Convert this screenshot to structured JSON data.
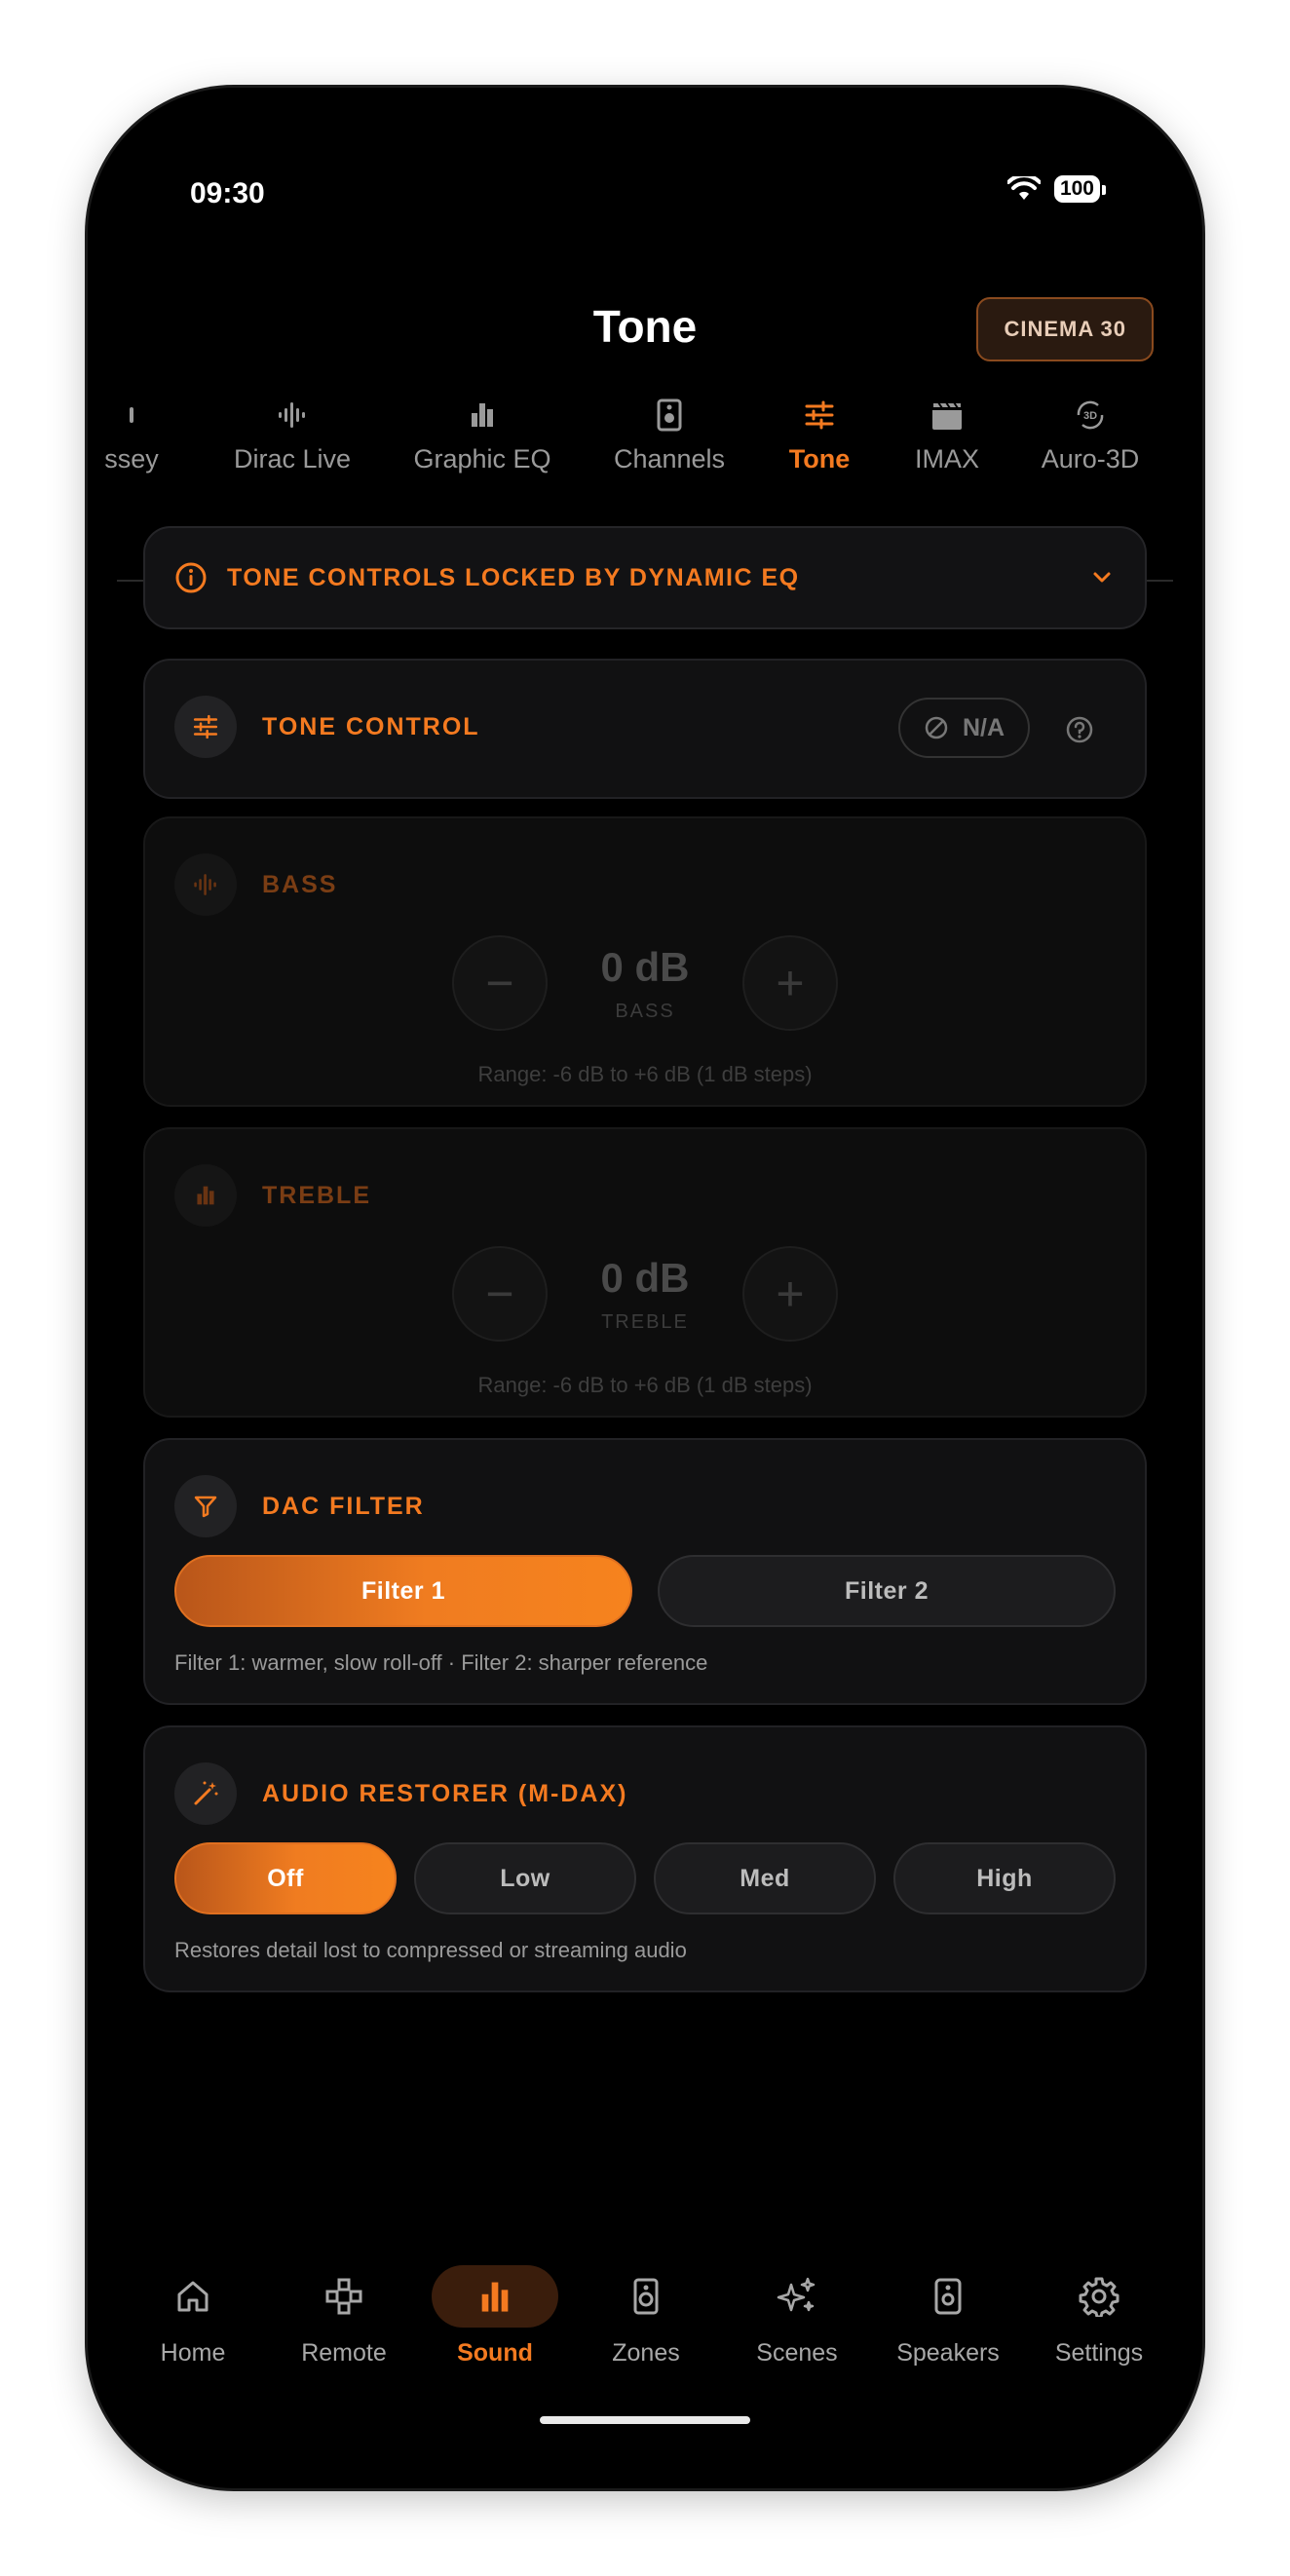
{
  "status": {
    "time": "09:30",
    "battery": "100"
  },
  "header": {
    "title": "Tone",
    "preset": "CINEMA 30"
  },
  "tabs": [
    {
      "label": "ssey",
      "icon": "audyssey-icon"
    },
    {
      "label": "Dirac Live",
      "icon": "waveform-icon"
    },
    {
      "label": "Graphic EQ",
      "icon": "bar-chart-icon"
    },
    {
      "label": "Channels",
      "icon": "speaker-icon"
    },
    {
      "label": "Tone",
      "icon": "sliders-icon",
      "active": true
    },
    {
      "label": "IMAX",
      "icon": "clapperboard-icon"
    },
    {
      "label": "Auro-3D",
      "icon": "3d-rotate-icon"
    }
  ],
  "alert": {
    "text": "TONE CONTROLS LOCKED BY DYNAMIC EQ"
  },
  "tone_control": {
    "title": "TONE CONTROL",
    "status": "N/A"
  },
  "bass": {
    "title": "BASS",
    "value": "0 dB",
    "label": "BASS",
    "range": "Range: -6 dB to +6 dB (1 dB steps)",
    "minus": "−",
    "plus": "+"
  },
  "treble": {
    "title": "TREBLE",
    "value": "0 dB",
    "label": "TREBLE",
    "range": "Range: -6 dB to +6 dB (1 dB steps)",
    "minus": "−",
    "plus": "+"
  },
  "dac_filter": {
    "title": "DAC FILTER",
    "options": [
      "Filter 1",
      "Filter 2"
    ],
    "selected": "Filter 1",
    "helper": "Filter 1: warmer, slow roll-off · Filter 2: sharper reference"
  },
  "audio_restorer": {
    "title": "AUDIO RESTORER (M-DAX)",
    "options": [
      "Off",
      "Low",
      "Med",
      "High"
    ],
    "selected": "Off",
    "helper": "Restores detail lost to compressed or streaming audio"
  },
  "nav": [
    {
      "label": "Home",
      "icon": "home-icon"
    },
    {
      "label": "Remote",
      "icon": "remote-icon"
    },
    {
      "label": "Sound",
      "icon": "bar-chart-icon",
      "active": true
    },
    {
      "label": "Zones",
      "icon": "speakers-icon"
    },
    {
      "label": "Scenes",
      "icon": "sparkle-icon"
    },
    {
      "label": "Speakers",
      "icon": "speaker-icon"
    },
    {
      "label": "Settings",
      "icon": "gear-icon"
    }
  ],
  "colors": {
    "accent": "#f47a20",
    "background": "#000000",
    "card": "#111112"
  }
}
